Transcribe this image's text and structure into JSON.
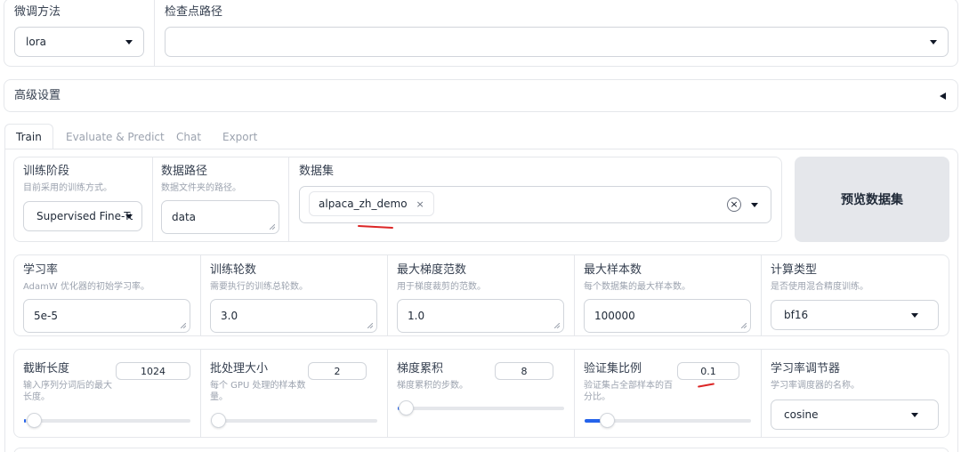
{
  "top": {
    "finetune_method": {
      "label": "微调方法",
      "value": "lora"
    },
    "checkpoint_path": {
      "label": "检查点路径",
      "value": ""
    }
  },
  "advanced": {
    "label": "高级设置"
  },
  "tabs": [
    {
      "label": "Train",
      "active": true
    },
    {
      "label": "Evaluate & Predict",
      "active": false
    },
    {
      "label": "Chat",
      "active": false
    },
    {
      "label": "Export",
      "active": false
    }
  ],
  "train": {
    "stage": {
      "label": "训练阶段",
      "info": "目前采用的训练方式。",
      "value": "Supervised Fine-Tuning"
    },
    "dataset_dir": {
      "label": "数据路径",
      "info": "数据文件夹的路径。",
      "value": "data"
    },
    "dataset": {
      "label": "数据集",
      "chip": "alpaca_zh_demo",
      "chip_close": "×",
      "clear": "×"
    },
    "preview_button": "预览数据集",
    "learning_rate": {
      "label": "学习率",
      "info": "AdamW 优化器的初始学习率。",
      "value": "5e-5"
    },
    "num_epochs": {
      "label": "训练轮数",
      "info": "需要执行的训练总轮数。",
      "value": "3.0"
    },
    "max_grad_norm": {
      "label": "最大梯度范数",
      "info": "用于梯度裁剪的范数。",
      "value": "1.0"
    },
    "max_samples": {
      "label": "最大样本数",
      "info": "每个数据集的最大样本数。",
      "value": "100000"
    },
    "compute_type": {
      "label": "计算类型",
      "info": "是否使用混合精度训练。",
      "value": "bf16"
    },
    "cutoff_len": {
      "label": "截断长度",
      "info": "输入序列分词后的最大长度。",
      "value": "1024",
      "slider_fraction": 0.01
    },
    "batch_size": {
      "label": "批处理大小",
      "info": "每个 GPU 处理的样本数量。",
      "value": "2",
      "slider_fraction": 0.0
    },
    "grad_accum": {
      "label": "梯度累积",
      "info": "梯度累积的步数。",
      "value": "8",
      "slider_fraction": 0.03
    },
    "val_size": {
      "label": "验证集比例",
      "info": "验证集占全部样本的百分比。",
      "value": "0.1",
      "slider_fraction": 0.1
    },
    "lr_scheduler": {
      "label": "学习率调节器",
      "info": "学习率调度器的名称。",
      "value": "cosine"
    }
  },
  "colors": {
    "accent": "#2563eb",
    "annotation": "#dc2626",
    "border": "#e5e7eb"
  }
}
